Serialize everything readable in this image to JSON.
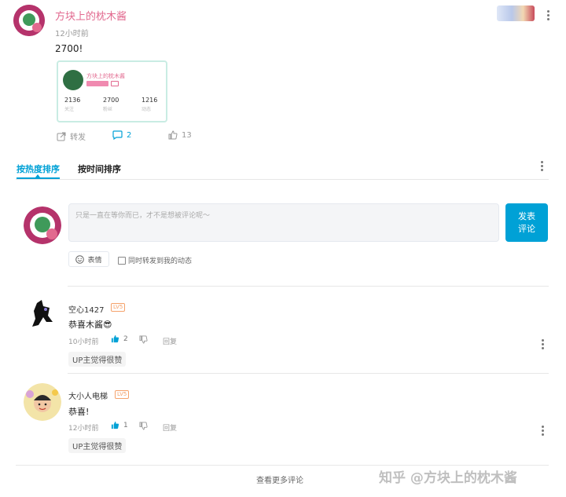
{
  "post": {
    "author": "方块上的枕木酱",
    "time": "12小时前",
    "content": "2700!",
    "card": {
      "name": "方块上的枕木酱",
      "stats": [
        {
          "value": "2136",
          "label": "关注"
        },
        {
          "value": "2700",
          "label": "粉丝"
        },
        {
          "value": "1216",
          "label": "动态"
        }
      ]
    },
    "actions": {
      "share": "转发",
      "comments": "2",
      "likes": "13"
    }
  },
  "sort_tabs": {
    "hot": "按热度排序",
    "time": "按时间排序"
  },
  "composer": {
    "placeholder": "只是一直在等你而已，才不是想被评论呢～",
    "submit_line1": "发表",
    "submit_line2": "评论",
    "emoji_label": "表情",
    "repost_label": "同时转发到我的动态"
  },
  "comments": [
    {
      "name": "空心1427",
      "level": "LV5",
      "text": "恭喜木酱😎",
      "time": "10小时前",
      "likes": "2",
      "reply": "回复",
      "tag": "UP主觉得很赞"
    },
    {
      "name": "大小人电梯",
      "level": "LV5",
      "text": "恭喜!",
      "time": "12小时前",
      "likes": "1",
      "reply": "回复",
      "tag": "UP主觉得很赞"
    }
  ],
  "more_comments": "查看更多评论",
  "watermark": "知乎 @方块上的枕木酱",
  "colors": {
    "accent": "#00a1d6",
    "pink": "#e2698f"
  }
}
